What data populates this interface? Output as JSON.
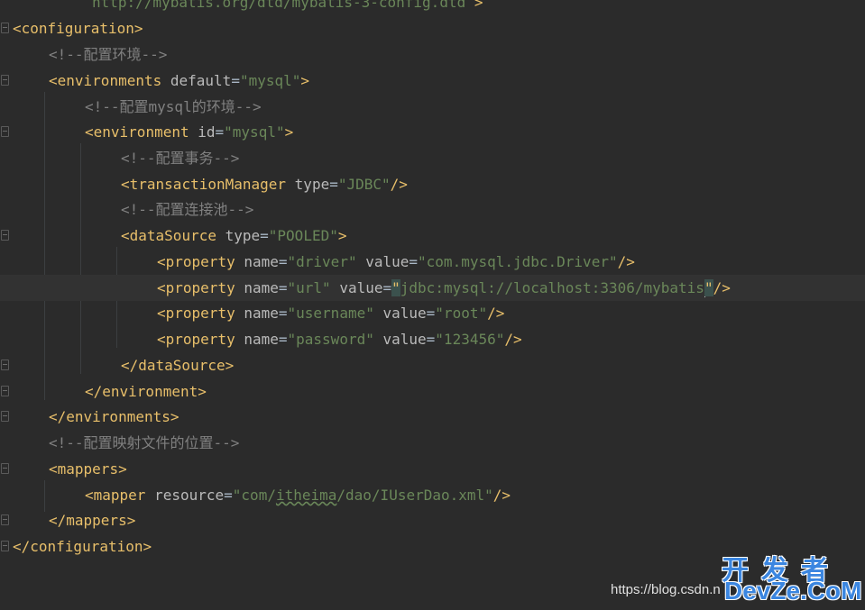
{
  "editor": {
    "lines": {
      "l0": {
        "value": "http://mybatis.org/dtd/mybatis-3-config.dtd"
      },
      "l1": {
        "tag": "configuration"
      },
      "l2": {
        "comment": "<!--配置环境-->"
      },
      "l3": {
        "tag": "environments",
        "attr": "default",
        "value": "\"mysql\""
      },
      "l4": {
        "comment": "<!--配置mysql的环境-->"
      },
      "l5": {
        "tag": "environment",
        "attr": "id",
        "value": "\"mysql\""
      },
      "l6": {
        "comment": "<!--配置事务-->"
      },
      "l7": {
        "tag": "transactionManager",
        "attr": "type",
        "value": "\"JDBC\""
      },
      "l8": {
        "comment": "<!--配置连接池-->"
      },
      "l9": {
        "tag": "dataSource",
        "attr": "type",
        "value": "\"POOLED\""
      },
      "l10": {
        "tag": "property",
        "attr1": "name",
        "value1": "\"driver\"",
        "attr2": "value",
        "value2": "\"com.mysql.jdbc.Driver\""
      },
      "l11": {
        "tag": "property",
        "attr1": "name",
        "value1": "\"url\"",
        "attr2": "value",
        "quote_open": "\"",
        "value2": "jdbc:mysql://localhost:3306/mybatis",
        "quote_close": "\""
      },
      "l12": {
        "tag": "property",
        "attr1": "name",
        "value1": "\"username\"",
        "attr2": "value",
        "value2": "\"root\""
      },
      "l13": {
        "tag": "property",
        "attr1": "name",
        "value1": "\"password\"",
        "attr2": "value",
        "value2": "\"123456\""
      },
      "l14": {
        "tag": "dataSource"
      },
      "l15": {
        "tag": "environment"
      },
      "l16": {
        "tag": "environments"
      },
      "l17": {
        "comment": "<!--配置映射文件的位置-->"
      },
      "l18": {
        "tag": "mappers"
      },
      "l19": {
        "tag": "mapper",
        "attr": "resource",
        "q": "\"",
        "v_a": "com/",
        "v_b": "itheima",
        "v_c": "/dao/IUserDao.xml",
        "q2": "\""
      },
      "l20": {
        "tag": "mappers"
      },
      "l21": {
        "tag": "configuration"
      }
    }
  },
  "watermark": {
    "url": "https://blog.csdn.n",
    "logo_cn": "开发者",
    "logo_en": "DevZe.CoM"
  },
  "colors": {
    "background": "#2b2b2b",
    "tag": "#e8bf6a",
    "attribute": "#bababa",
    "string": "#6a8759",
    "comment": "#808080",
    "text": "#a9b7c6"
  }
}
